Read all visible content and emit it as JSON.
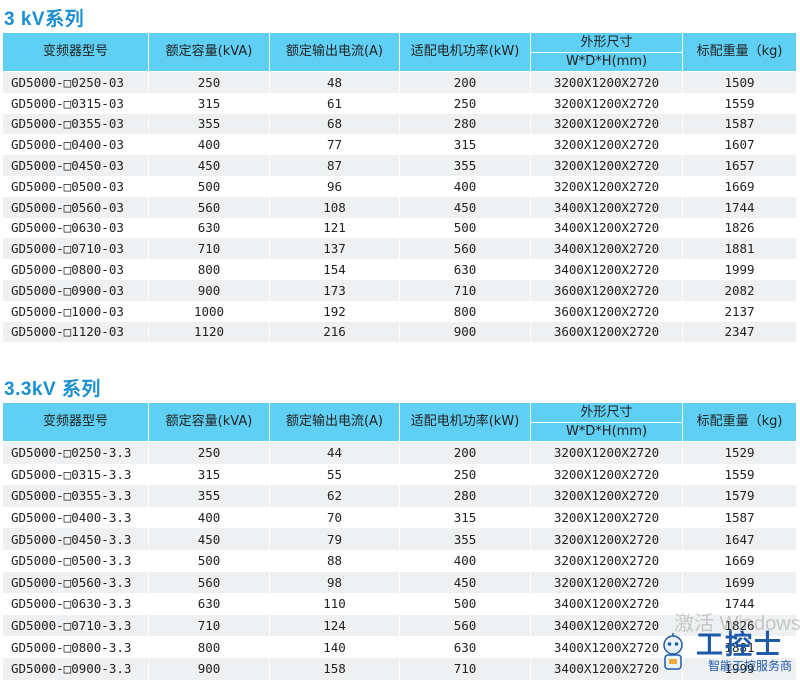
{
  "sections": [
    {
      "title": "3 kV系列",
      "headers": {
        "model": "变频器型号",
        "capacity": "额定容量(kVA)",
        "current": "额定输出电流(A)",
        "motor": "适配电机功率(kW)",
        "dims": "外形尺寸",
        "dims_sub": "W*D*H(mm)",
        "weight": "标配重量（kg)"
      },
      "rows": [
        [
          "GD5000-□0250-03",
          "250",
          "48",
          "200",
          "3200X1200X2720",
          "1509"
        ],
        [
          "GD5000-□0315-03",
          "315",
          "61",
          "250",
          "3200X1200X2720",
          "1559"
        ],
        [
          "GD5000-□0355-03",
          "355",
          "68",
          "280",
          "3200X1200X2720",
          "1587"
        ],
        [
          "GD5000-□0400-03",
          "400",
          "77",
          "315",
          "3200X1200X2720",
          "1607"
        ],
        [
          "GD5000-□0450-03",
          "450",
          "87",
          "355",
          "3200X1200X2720",
          "1657"
        ],
        [
          "GD5000-□0500-03",
          "500",
          "96",
          "400",
          "3200X1200X2720",
          "1669"
        ],
        [
          "GD5000-□0560-03",
          "560",
          "108",
          "450",
          "3400X1200X2720",
          "1744"
        ],
        [
          "GD5000-□0630-03",
          "630",
          "121",
          "500",
          "3400X1200X2720",
          "1826"
        ],
        [
          "GD5000-□0710-03",
          "710",
          "137",
          "560",
          "3400X1200X2720",
          "1881"
        ],
        [
          "GD5000-□0800-03",
          "800",
          "154",
          "630",
          "3400X1200X2720",
          "1999"
        ],
        [
          "GD5000-□0900-03",
          "900",
          "173",
          "710",
          "3600X1200X2720",
          "2082"
        ],
        [
          "GD5000-□1000-03",
          "1000",
          "192",
          "800",
          "3600X1200X2720",
          "2137"
        ],
        [
          "GD5000-□1120-03",
          "1120",
          "216",
          "900",
          "3600X1200X2720",
          "2347"
        ]
      ]
    },
    {
      "title": "3.3kV 系列",
      "headers": {
        "model": "变频器型号",
        "capacity": "额定容量(kVA)",
        "current": "额定输出电流(A)",
        "motor": "适配电机功率(kW)",
        "dims": "外形尺寸",
        "dims_sub": "W*D*H(mm)",
        "weight": "标配重量（kg)"
      },
      "rows": [
        [
          "GD5000-□0250-3.3",
          "250",
          "44",
          "200",
          "3200X1200X2720",
          "1529"
        ],
        [
          "GD5000-□0315-3.3",
          "315",
          "55",
          "250",
          "3200X1200X2720",
          "1559"
        ],
        [
          "GD5000-□0355-3.3",
          "355",
          "62",
          "280",
          "3200X1200X2720",
          "1579"
        ],
        [
          "GD5000-□0400-3.3",
          "400",
          "70",
          "315",
          "3200X1200X2720",
          "1587"
        ],
        [
          "GD5000-□0450-3.3",
          "450",
          "79",
          "355",
          "3200X1200X2720",
          "1647"
        ],
        [
          "GD5000-□0500-3.3",
          "500",
          "88",
          "400",
          "3200X1200X2720",
          "1669"
        ],
        [
          "GD5000-□0560-3.3",
          "560",
          "98",
          "450",
          "3200X1200X2720",
          "1699"
        ],
        [
          "GD5000-□0630-3.3",
          "630",
          "110",
          "500",
          "3400X1200X2720",
          "1744"
        ],
        [
          "GD5000-□0710-3.3",
          "710",
          "124",
          "560",
          "3400X1200X2720",
          "1826"
        ],
        [
          "GD5000-□0800-3.3",
          "800",
          "140",
          "630",
          "3400X1200X2720",
          "1881"
        ],
        [
          "GD5000-□0900-3.3",
          "900",
          "158",
          "710",
          "3400X1200X2720",
          "1999"
        ]
      ]
    }
  ],
  "watermark": {
    "line1": "激活 Windows",
    "line2": "工控士",
    "line3": "智能工控服务商",
    "icon": "robot-mascot-icon",
    "brand_color": "#1e5aa8"
  },
  "colors": {
    "header_bg": "#5fd0f4",
    "title": "#1a8fd6",
    "row_stripe": "#eef0f1"
  }
}
